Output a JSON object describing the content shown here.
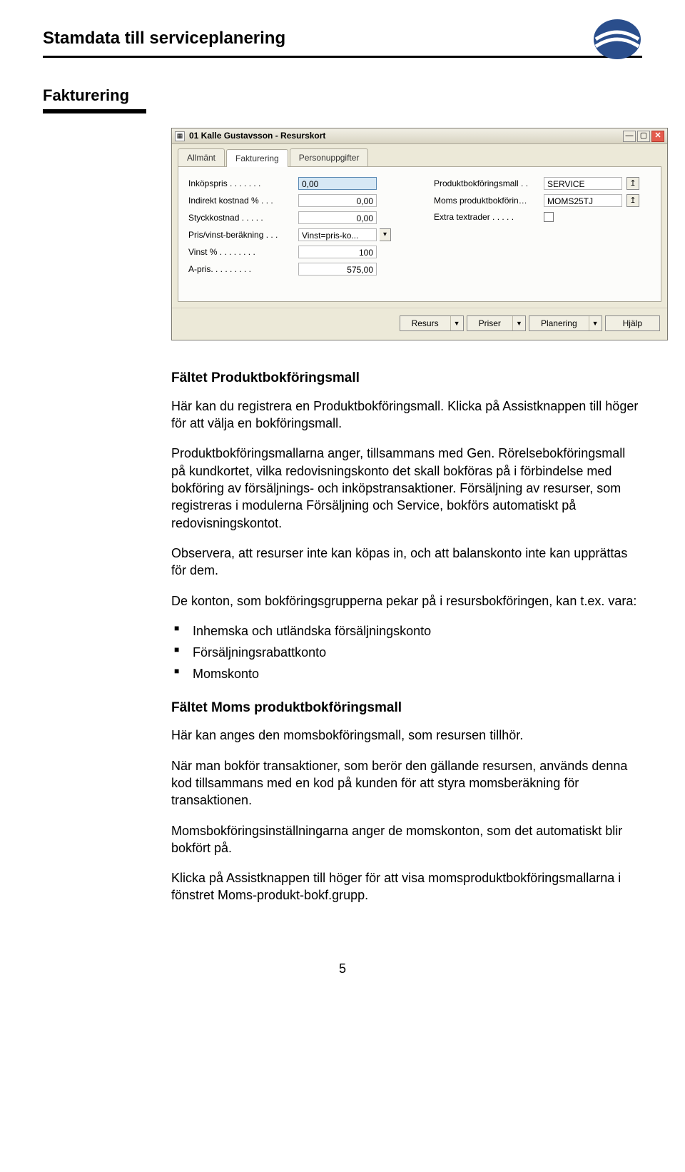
{
  "header": {
    "title": "Stamdata till serviceplanering"
  },
  "section": {
    "title": "Fakturering"
  },
  "window": {
    "title": "01 Kalle Gustavsson - Resurskort",
    "tabs": [
      "Allmänt",
      "Fakturering",
      "Personuppgifter"
    ],
    "active_tab_index": 1,
    "left_fields": [
      {
        "label": "Inköpspris . . . . . . .",
        "value": "0,00",
        "highlight": true,
        "align": "left"
      },
      {
        "label": "Indirekt kostnad % . . .",
        "value": "0,00"
      },
      {
        "label": "Styckkostnad . . . . .",
        "value": "0,00"
      },
      {
        "label": "Pris/vinst-beräkning . . .",
        "value": "Vinst=pris-ko...",
        "combo": true,
        "align": "left"
      },
      {
        "label": "Vinst % . . . . . . . .",
        "value": "100"
      },
      {
        "label": "A-pris. . . . . . . . .",
        "value": "575,00"
      }
    ],
    "right_fields": [
      {
        "label": "Produktbokföringsmall . .",
        "value": "SERVICE",
        "assist": true,
        "align": "left"
      },
      {
        "label": "Moms produktbokförin…",
        "value": "MOMS25TJ",
        "assist": true,
        "align": "left"
      },
      {
        "label": "Extra textrader . . . . .",
        "checkbox": true
      }
    ],
    "footer_buttons": [
      {
        "label": "Resurs",
        "caret": true
      },
      {
        "label": "Priser",
        "caret": true
      },
      {
        "label": "Planering",
        "caret": true
      },
      {
        "label": "Hjälp",
        "caret": false
      }
    ]
  },
  "body": {
    "h_field1": "Fältet Produktbokföringsmall",
    "p1": "Här kan du registrera en Produktbokföringsmall. Klicka på Assistknappen till höger för att välja en bokföringsmall.",
    "p2": "Produktbokföringsmallarna anger, tillsammans med Gen. Rörelsebokföringsmall på kundkortet, vilka redovisningskonto det skall bokföras på i förbindelse med bokföring av försäljnings- och inköpstransaktioner. Försäljning av resurser, som registreras i modulerna Försäljning och Service, bokförs automatiskt på redovisningskontot.",
    "p3": "Observera, att resurser inte kan köpas in, och att balanskonto inte kan upprättas för dem.",
    "p4": "De konton, som bokföringsgrupperna pekar på i resursbokföringen, kan t.ex. vara:",
    "bullets": [
      "Inhemska och utländska försäljningskonto",
      "Försäljningsrabattkonto",
      "Momskonto"
    ],
    "h_field2": "Fältet Moms produktbokföringsmall",
    "p5": "Här kan anges den momsbokföringsmall, som resursen tillhör.",
    "p6": "När man bokför transaktioner, som berör den gällande resursen, används denna kod tillsammans med en kod på kunden för att styra momsberäkning för transaktionen.",
    "p7": "Momsbokföringsinställningarna anger de momskonton, som det automatiskt blir bokfört på.",
    "p8": "Klicka på Assistknappen till höger för att visa momsproduktbokföringsmallarna i fönstret Moms-produkt-bokf.grupp."
  },
  "page_number": "5"
}
